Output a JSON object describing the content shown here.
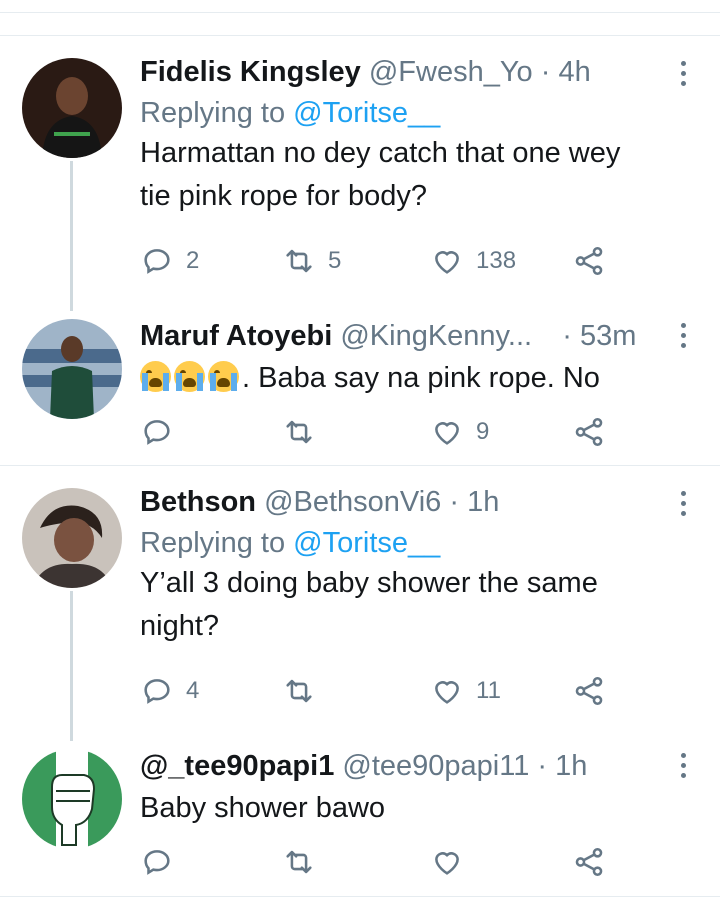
{
  "tweets": [
    {
      "name": "Fidelis Kingsley",
      "handle": "@Fwesh_Yo",
      "separator": "·",
      "time": "4h",
      "replying_prefix": "Replying to ",
      "replying_to": "@Toritse__",
      "text_line1": "Harmattan no dey catch that one wey",
      "text_line2": "tie pink rope for body?",
      "reply_count": "2",
      "retweet_count": "5",
      "like_count": "138"
    },
    {
      "name": "Maruf Atoyebi",
      "handle": "@KingKenny...",
      "separator": "·",
      "time": "53m",
      "emojis": [
        "loudly-crying-face",
        "loudly-crying-face",
        "loudly-crying-face"
      ],
      "text_line1": ". Baba say na pink rope. No",
      "reply_count": "",
      "retweet_count": "",
      "like_count": "9"
    },
    {
      "name": "Bethson",
      "handle": "@BethsonVi6",
      "separator": "·",
      "time": "1h",
      "replying_prefix": "Replying to ",
      "replying_to": "@Toritse__",
      "text_line1": "Y’all 3 doing baby shower the same",
      "text_line2": "night?",
      "reply_count": "4",
      "retweet_count": "",
      "like_count": "11"
    },
    {
      "name": "@_tee90papi1",
      "handle": "@tee90papi11",
      "separator": "·",
      "time": "1h",
      "text_line1": "Baby shower bawo",
      "reply_count": "",
      "retweet_count": "",
      "like_count": ""
    }
  ],
  "colors": {
    "accent": "#1da1f2",
    "secondary_text": "#657786",
    "primary_text": "#14171a",
    "divider": "#e6ecf0",
    "avatar_4_bg": "#3a9a5b"
  },
  "icons": [
    "reply-icon",
    "retweet-icon",
    "like-icon",
    "share-icon",
    "more-icon"
  ]
}
